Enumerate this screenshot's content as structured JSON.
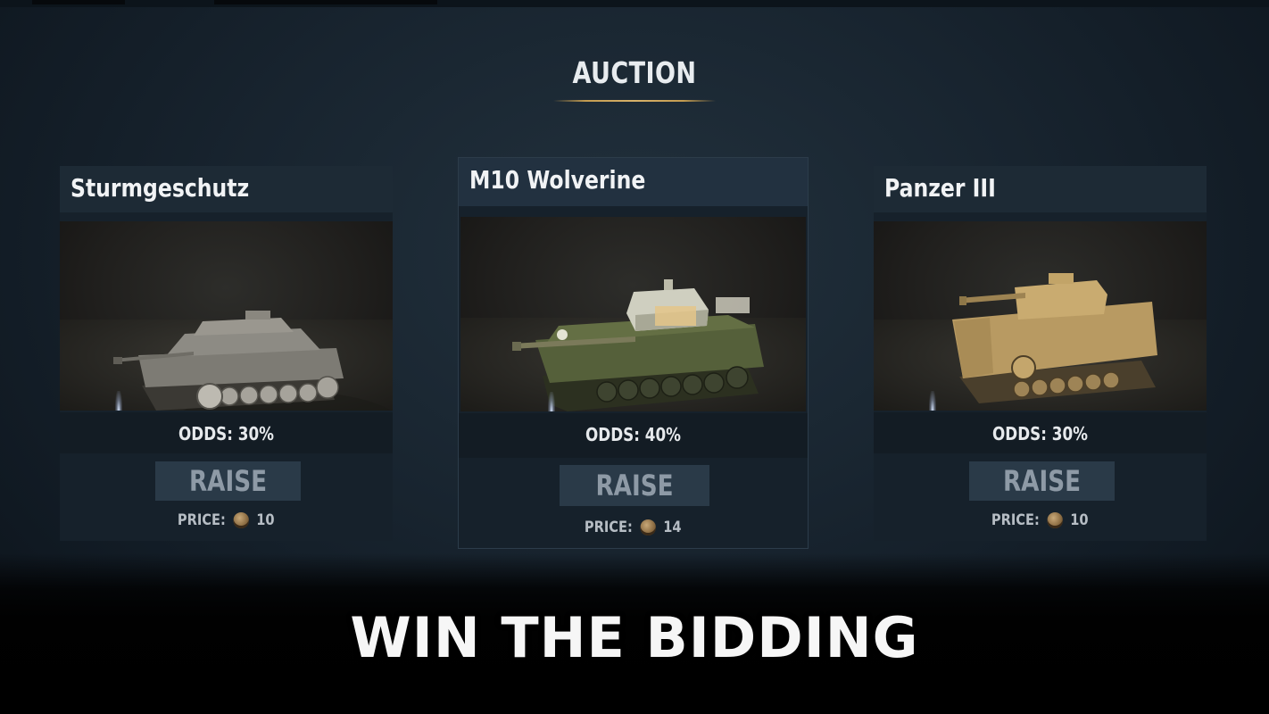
{
  "title": "AUCTION",
  "caption": "WIN THE BIDDING",
  "accent_color": "#c49c50",
  "cards": [
    {
      "name": "Sturmgeschutz",
      "odds": "ODDS: 30%",
      "raise_label": "RAISE",
      "price_label": "PRICE:",
      "price_value": "10",
      "currency_icon": "coin-icon",
      "tank_color": "#8d8b84"
    },
    {
      "name": "M10 Wolverine",
      "odds": "ODDS: 40%",
      "raise_label": "RAISE",
      "price_label": "PRICE:",
      "price_value": "14",
      "currency_icon": "coin-icon",
      "tank_color": "#5c6640"
    },
    {
      "name": "Panzer III",
      "odds": "ODDS: 30%",
      "raise_label": "RAISE",
      "price_label": "PRICE:",
      "price_value": "10",
      "currency_icon": "coin-icon",
      "tank_color": "#b89a62"
    }
  ]
}
